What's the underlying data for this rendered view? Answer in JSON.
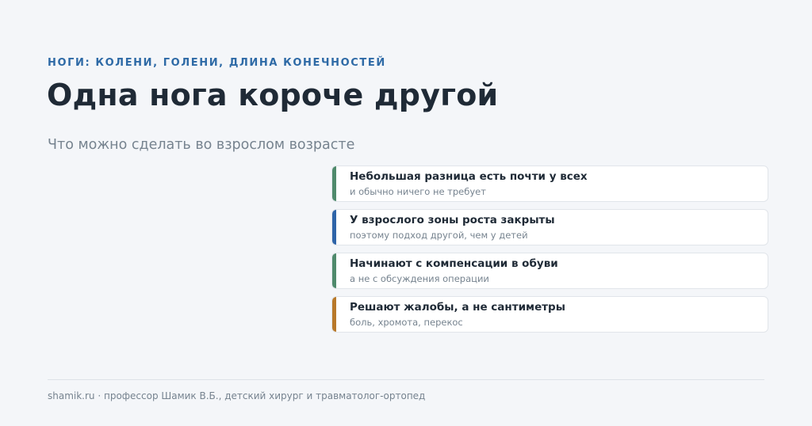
{
  "header": {
    "eyebrow": "НОГИ: КОЛЕНИ, ГОЛЕНИ, ДЛИНА КОНЕЧНОСТЕЙ",
    "title": "Одна нога короче другой",
    "subtitle": "Что можно сделать во взрослом возрасте"
  },
  "cards": [
    {
      "title": "Небольшая разница есть почти у всех",
      "subtitle": "и обычно ничего не требует",
      "accent": "#4f8a6c"
    },
    {
      "title": "У взрослого зоны роста закрыты",
      "subtitle": "поэтому подход другой, чем у детей",
      "accent": "#2e64a8"
    },
    {
      "title": "Начинают с компенсации в обуви",
      "subtitle": "а не с обсуждения операции",
      "accent": "#4f8a6c"
    },
    {
      "title": "Решают жалобы, а не сантиметры",
      "subtitle": "боль, хромота, перекос",
      "accent": "#b8792a"
    }
  ],
  "footer": {
    "text": "shamik.ru · профессор Шамик В.Б., детский хирург и травматолог-ортопед"
  }
}
